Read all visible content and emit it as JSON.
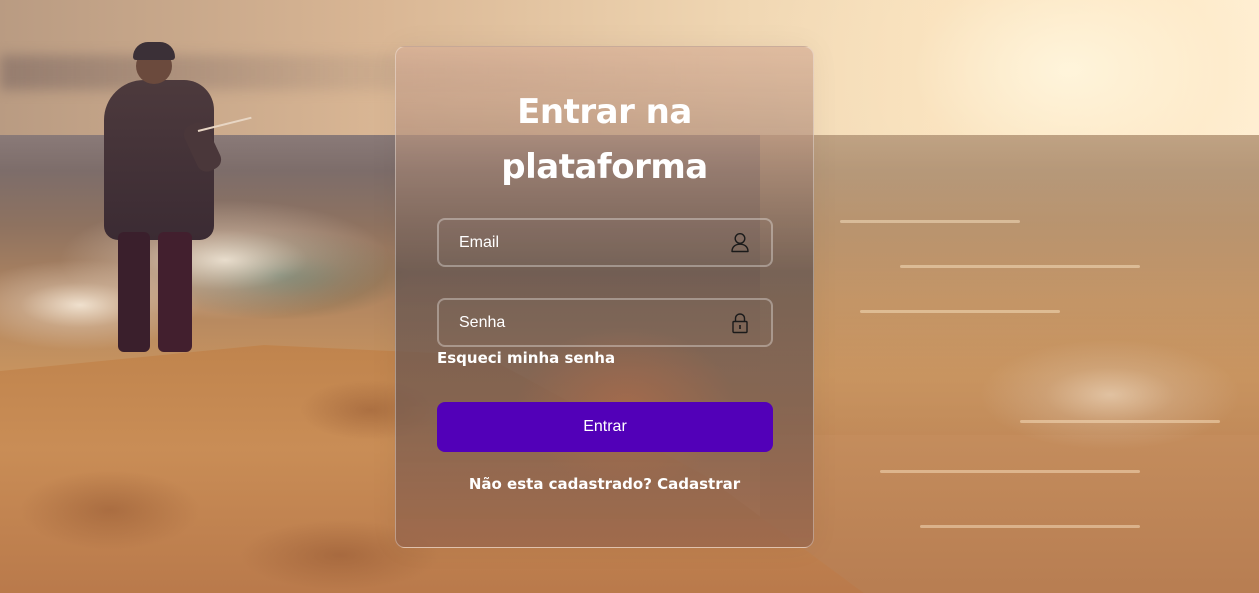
{
  "login": {
    "title": "Entrar na plataforma",
    "email": {
      "placeholder": "Email",
      "icon": "user-icon"
    },
    "password": {
      "placeholder": "Senha",
      "icon": "lock-icon"
    },
    "forgot_link": "Esqueci minha senha",
    "submit_label": "Entrar",
    "register_prompt": "Não esta cadastrado?",
    "register_link": "Cadastrar"
  },
  "colors": {
    "accent": "#5200b8",
    "text": "#ffffff"
  }
}
